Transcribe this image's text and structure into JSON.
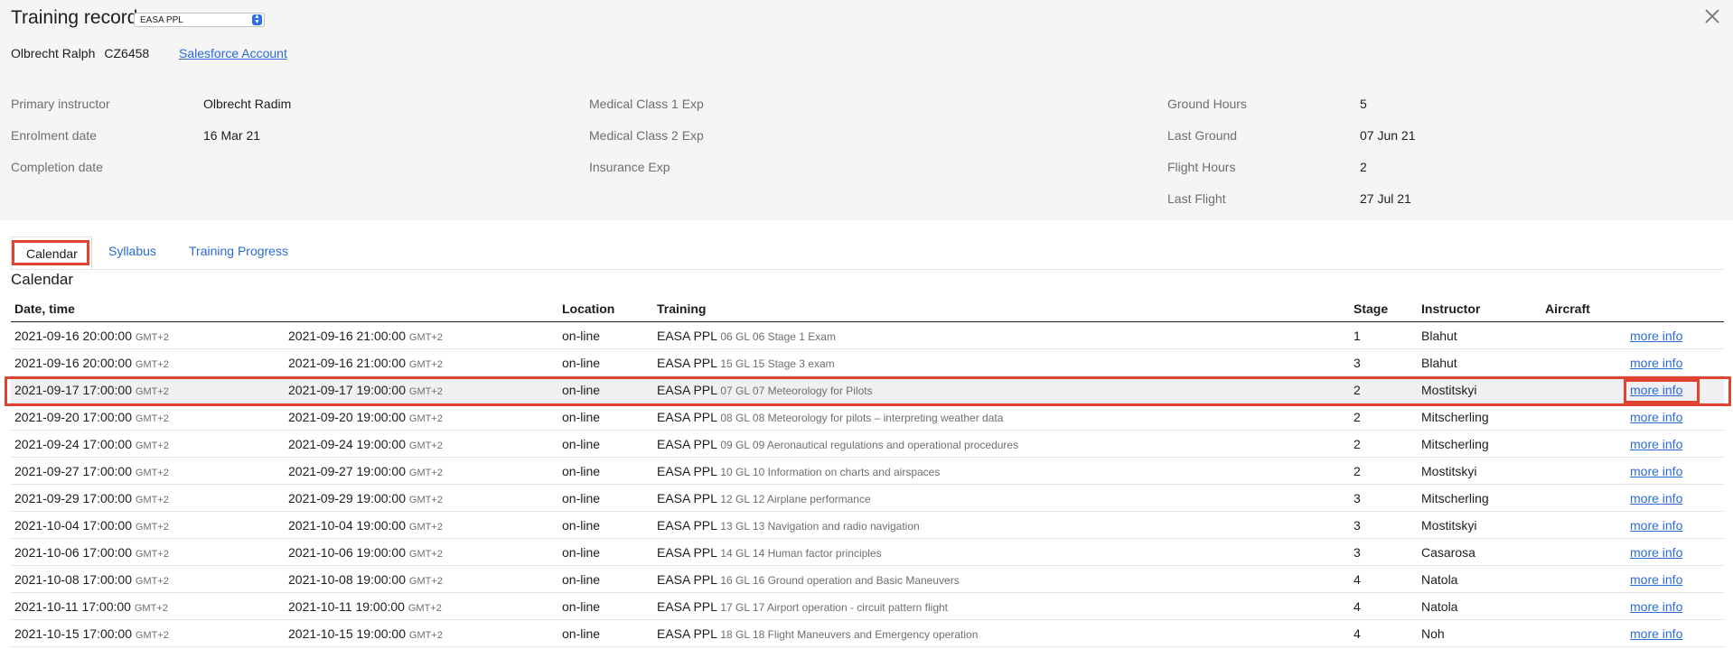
{
  "header": {
    "title": "Training record",
    "program_select": "EASA PPL",
    "student_name": "Olbrecht Ralph",
    "student_code": "CZ6458",
    "salesforce_link": "Salesforce Account"
  },
  "details": {
    "primary_instructor_label": "Primary instructor",
    "primary_instructor": "Olbrecht Radim",
    "enrolment_label": "Enrolment date",
    "enrolment": "16 Mar 21",
    "completion_label": "Completion date",
    "completion": "",
    "medical1_label": "Medical Class 1 Exp",
    "medical2_label": "Medical Class 2 Exp",
    "insurance_label": "Insurance Exp",
    "ground_hours_label": "Ground Hours",
    "ground_hours": "5",
    "last_ground_label": "Last Ground",
    "last_ground": "07 Jun 21",
    "flight_hours_label": "Flight Hours",
    "flight_hours": "2",
    "last_flight_label": "Last Flight",
    "last_flight": "27 Jul 21"
  },
  "tabs": [
    "Calendar",
    "Syllabus",
    "Training Progress"
  ],
  "calendar": {
    "title": "Calendar",
    "columns": {
      "date": "Date, time",
      "location": "Location",
      "training": "Training",
      "stage": "Stage",
      "instructor": "Instructor",
      "aircraft": "Aircraft"
    },
    "rows": [
      {
        "start": "2021-09-16 20:00:00",
        "tz1": "GMT+2",
        "end": "2021-09-16 21:00:00",
        "tz2": "GMT+2",
        "location": "on-line",
        "program": "EASA PPL",
        "lesson": "06 GL 06 Stage 1 Exam",
        "stage": "1",
        "instructor": "Blahut",
        "link": "more info"
      },
      {
        "start": "2021-09-16 20:00:00",
        "tz1": "GMT+2",
        "end": "2021-09-16 21:00:00",
        "tz2": "GMT+2",
        "location": "on-line",
        "program": "EASA PPL",
        "lesson": "15 GL 15 Stage 3 exam",
        "stage": "3",
        "instructor": "Blahut",
        "link": "more info"
      },
      {
        "start": "2021-09-17 17:00:00",
        "tz1": "GMT+2",
        "end": "2021-09-17 19:00:00",
        "tz2": "GMT+2",
        "location": "on-line",
        "program": "EASA PPL",
        "lesson": "07 GL 07 Meteorology for Pilots",
        "stage": "2",
        "instructor": "Mostitskyi",
        "link": "more info"
      },
      {
        "start": "2021-09-20 17:00:00",
        "tz1": "GMT+2",
        "end": "2021-09-20 19:00:00",
        "tz2": "GMT+2",
        "location": "on-line",
        "program": "EASA PPL",
        "lesson": "08 GL 08 Meteorology for pilots – interpreting weather data",
        "stage": "2",
        "instructor": "Mitscherling",
        "link": "more info"
      },
      {
        "start": "2021-09-24 17:00:00",
        "tz1": "GMT+2",
        "end": "2021-09-24 19:00:00",
        "tz2": "GMT+2",
        "location": "on-line",
        "program": "EASA PPL",
        "lesson": "09 GL 09 Aeronautical regulations and operational procedures",
        "stage": "2",
        "instructor": "Mitscherling",
        "link": "more info"
      },
      {
        "start": "2021-09-27 17:00:00",
        "tz1": "GMT+2",
        "end": "2021-09-27 19:00:00",
        "tz2": "GMT+2",
        "location": "on-line",
        "program": "EASA PPL",
        "lesson": "10 GL 10 Information on charts and airspaces",
        "stage": "2",
        "instructor": "Mostitskyi",
        "link": "more info"
      },
      {
        "start": "2021-09-29 17:00:00",
        "tz1": "GMT+2",
        "end": "2021-09-29 19:00:00",
        "tz2": "GMT+2",
        "location": "on-line",
        "program": "EASA PPL",
        "lesson": "12 GL 12 Airplane performance",
        "stage": "3",
        "instructor": "Mitscherling",
        "link": "more info"
      },
      {
        "start": "2021-10-04 17:00:00",
        "tz1": "GMT+2",
        "end": "2021-10-04 19:00:00",
        "tz2": "GMT+2",
        "location": "on-line",
        "program": "EASA PPL",
        "lesson": "13 GL 13 Navigation and radio navigation",
        "stage": "3",
        "instructor": "Mostitskyi",
        "link": "more info"
      },
      {
        "start": "2021-10-06 17:00:00",
        "tz1": "GMT+2",
        "end": "2021-10-06 19:00:00",
        "tz2": "GMT+2",
        "location": "on-line",
        "program": "EASA PPL",
        "lesson": "14 GL 14 Human factor principles",
        "stage": "3",
        "instructor": "Casarosa",
        "link": "more info"
      },
      {
        "start": "2021-10-08 17:00:00",
        "tz1": "GMT+2",
        "end": "2021-10-08 19:00:00",
        "tz2": "GMT+2",
        "location": "on-line",
        "program": "EASA PPL",
        "lesson": "16 GL 16 Ground operation and Basic Maneuvers",
        "stage": "4",
        "instructor": "Natola",
        "link": "more info"
      },
      {
        "start": "2021-10-11 17:00:00",
        "tz1": "GMT+2",
        "end": "2021-10-11 19:00:00",
        "tz2": "GMT+2",
        "location": "on-line",
        "program": "EASA PPL",
        "lesson": "17 GL 17 Airport operation - circuit pattern flight",
        "stage": "4",
        "instructor": "Natola",
        "link": "more info"
      },
      {
        "start": "2021-10-15 17:00:00",
        "tz1": "GMT+2",
        "end": "2021-10-15 19:00:00",
        "tz2": "GMT+2",
        "location": "on-line",
        "program": "EASA PPL",
        "lesson": "18 GL 18 Flight Maneuvers and Emergency operation",
        "stage": "4",
        "instructor": "Noh",
        "link": "more info"
      }
    ]
  },
  "colors": {
    "accent": "#2b6ad8",
    "highlight": "#e0432f",
    "header_bg": "#f5f5f6"
  },
  "icons": {
    "close": "close-icon",
    "select": "chevron-updown-icon"
  }
}
